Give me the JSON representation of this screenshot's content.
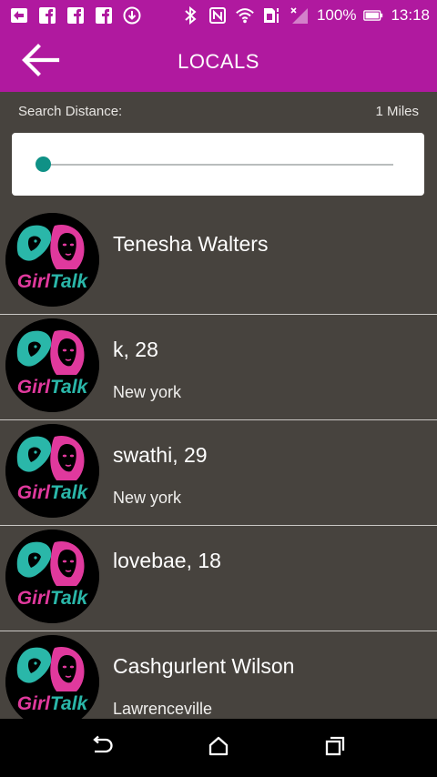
{
  "status_bar": {
    "battery": "100%",
    "time": "13:18",
    "icons": [
      "gallery-icon",
      "facebook-icon",
      "facebook-icon",
      "facebook-icon",
      "download-icon",
      "bluetooth-icon",
      "nfc-icon",
      "wifi-icon",
      "sim-icon",
      "signal-icon",
      "battery-icon"
    ]
  },
  "app_bar": {
    "title": "LOCALS",
    "back_icon": "arrow-left-icon"
  },
  "search": {
    "label": "Search Distance:",
    "value": "1 Miles",
    "slider_level": 0
  },
  "users": [
    {
      "name": "Tenesha Walters",
      "city": ""
    },
    {
      "name": "k, 28",
      "city": "New york"
    },
    {
      "name": "swathi, 29",
      "city": "New york"
    },
    {
      "name": "lovebae, 18",
      "city": ""
    },
    {
      "name": "Cashgurlent Wilson",
      "city": "Lawrenceville"
    }
  ],
  "avatar_logo_text": "GirlTalk",
  "colors": {
    "brand": "#b0199f",
    "background": "#47433e",
    "accent": "#0f9186",
    "logo_pink": "#e0399d",
    "logo_teal": "#2ab7a9"
  },
  "nav": {
    "icons": [
      "back-icon",
      "home-icon",
      "recents-icon"
    ]
  }
}
